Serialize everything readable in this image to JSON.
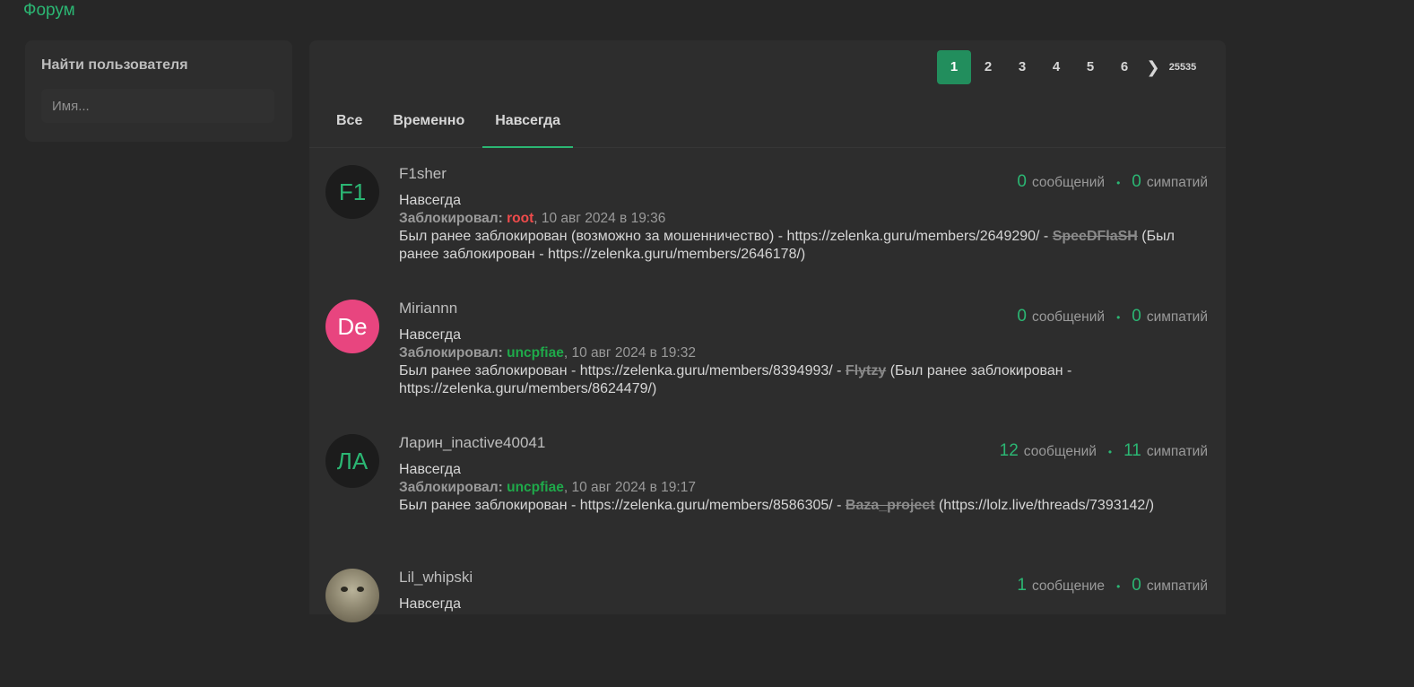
{
  "header": {
    "forum_link": "Форум"
  },
  "sidebar": {
    "title": "Найти пользователя",
    "search_placeholder": "Имя..."
  },
  "pagination": {
    "pages": [
      "1",
      "2",
      "3",
      "4",
      "5",
      "6"
    ],
    "active": "1",
    "next_glyph": "❯",
    "last": "25535"
  },
  "tabs": [
    {
      "label": "Все",
      "active": false
    },
    {
      "label": "Временно",
      "active": false
    },
    {
      "label": "Навсегда",
      "active": true
    }
  ],
  "colors": {
    "accent": "#2bb673",
    "mod_root": "#ef4b4b",
    "mod_green": "#1fa94a"
  },
  "bans": [
    {
      "username": "F1sher",
      "avatar_text": "F1",
      "avatar_bg": "#1c1c1c",
      "avatar_fg": "#2bb673",
      "ban_type": "Навсегда",
      "banned_by_label": "Заблокировал:",
      "moderator": "root",
      "moderator_color": "#ef4b4b",
      "date": ", 10 авг 2024 в 19:36",
      "reason_before": "Был ранее заблокирован (возможно за мошенничество) - https://zelenka.guru/members/2649290/ - ",
      "reason_strike": "SpeeDFlaSH",
      "reason_after": " (Был ранее заблокирован - https://zelenka.guru/members/2646178/)",
      "messages_count": "0",
      "messages_label": "сообщений",
      "likes_count": "0",
      "likes_label": "симпатий"
    },
    {
      "username": "Miriannn",
      "avatar_text": "De",
      "avatar_bg": "#e8457f",
      "avatar_fg": "#ffffff",
      "ban_type": "Навсегда",
      "banned_by_label": "Заблокировал:",
      "moderator": "uncpfiae",
      "moderator_color": "#1fa94a",
      "date": ", 10 авг 2024 в 19:32",
      "reason_before": "Был ранее заблокирован - https://zelenka.guru/members/8394993/ - ",
      "reason_strike": "Flytzy",
      "reason_after": " (Был ранее заблокирован - https://zelenka.guru/members/8624479/)",
      "messages_count": "0",
      "messages_label": "сообщений",
      "likes_count": "0",
      "likes_label": "симпатий"
    },
    {
      "username": "Ларин_inactive40041",
      "avatar_text": "ЛА",
      "avatar_bg": "#1c1c1c",
      "avatar_fg": "#2bb673",
      "ban_type": "Навсегда",
      "banned_by_label": "Заблокировал:",
      "moderator": "uncpfiae",
      "moderator_color": "#1fa94a",
      "date": ", 10 авг 2024 в 19:17",
      "reason_before": "Был ранее заблокирован - https://zelenka.guru/members/8586305/ - ",
      "reason_strike": "Baza_project",
      "reason_after": " (https://lolz.live/threads/7393142/)",
      "messages_count": "12",
      "messages_label": "сообщений",
      "likes_count": "11",
      "likes_label": "симпатий"
    },
    {
      "username": "Lil_whipski",
      "avatar_text": "",
      "avatar_bg": "",
      "avatar_fg": "",
      "ban_type": "Навсегда",
      "banned_by_label": "",
      "moderator": "",
      "moderator_color": "",
      "date": "",
      "reason_before": "",
      "reason_strike": "",
      "reason_after": "",
      "messages_count": "1",
      "messages_label": "сообщение",
      "likes_count": "0",
      "likes_label": "симпатий"
    }
  ]
}
